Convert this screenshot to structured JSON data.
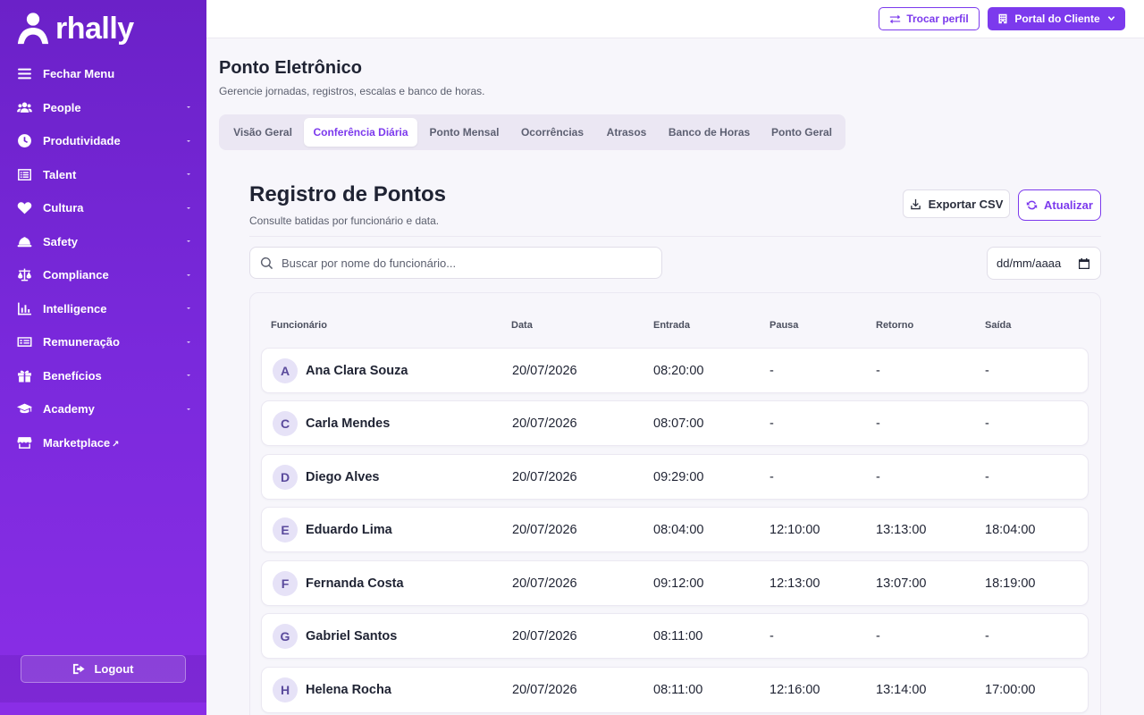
{
  "sidebar": {
    "brand": "rhally",
    "items": [
      {
        "label": "Fechar Menu",
        "icon": "menu-icon",
        "chevron": false
      },
      {
        "label": "People",
        "icon": "users-icon",
        "chevron": true
      },
      {
        "label": "Produtividade",
        "icon": "clock-icon",
        "chevron": true
      },
      {
        "label": "Talent",
        "icon": "list-icon",
        "chevron": true
      },
      {
        "label": "Cultura",
        "icon": "heart-icon",
        "chevron": true
      },
      {
        "label": "Safety",
        "icon": "helmet-icon",
        "chevron": true
      },
      {
        "label": "Compliance",
        "icon": "scale-icon",
        "chevron": true
      },
      {
        "label": "Intelligence",
        "icon": "chart-icon",
        "chevron": true
      },
      {
        "label": "Remuneração",
        "icon": "money-icon",
        "chevron": true
      },
      {
        "label": "Benefícios",
        "icon": "gift-icon",
        "chevron": true
      },
      {
        "label": "Academy",
        "icon": "graduation-icon",
        "chevron": true
      },
      {
        "label": "Marketplace",
        "icon": "store-icon",
        "chevron": false,
        "external": "↗"
      }
    ],
    "logout": "Logout"
  },
  "topbar": {
    "switch_profile": "Trocar perfil",
    "client_portal": "Portal do Cliente"
  },
  "page": {
    "title": "Ponto Eletrônico",
    "subtitle": "Gerencie jornadas, registros, escalas e banco de horas."
  },
  "tabs": [
    {
      "label": "Visão Geral",
      "active": false
    },
    {
      "label": "Conferência Diária",
      "active": true
    },
    {
      "label": "Ponto Mensal",
      "active": false
    },
    {
      "label": "Ocorrências",
      "active": false
    },
    {
      "label": "Atrasos",
      "active": false
    },
    {
      "label": "Banco de Horas",
      "active": false
    },
    {
      "label": "Ponto Geral",
      "active": false
    }
  ],
  "registro": {
    "title": "Registro de Pontos",
    "subtitle": "Consulte batidas por funcionário e data.",
    "export_label": "Exportar CSV",
    "refresh_label": "Atualizar",
    "search_placeholder": "Buscar por nome do funcionário...",
    "date_placeholder": "dd/mm/aaaa"
  },
  "table": {
    "headers": [
      "Funcionário",
      "Data",
      "Entrada",
      "Pausa",
      "Retorno",
      "Saída"
    ],
    "rows": [
      {
        "initial": "A",
        "name": "Ana Clara Souza",
        "data": "20/07/2026",
        "entrada": "08:20:00",
        "pausa": "-",
        "retorno": "-",
        "saida": "-"
      },
      {
        "initial": "C",
        "name": "Carla Mendes",
        "data": "20/07/2026",
        "entrada": "08:07:00",
        "pausa": "-",
        "retorno": "-",
        "saida": "-"
      },
      {
        "initial": "D",
        "name": "Diego Alves",
        "data": "20/07/2026",
        "entrada": "09:29:00",
        "pausa": "-",
        "retorno": "-",
        "saida": "-"
      },
      {
        "initial": "E",
        "name": "Eduardo Lima",
        "data": "20/07/2026",
        "entrada": "08:04:00",
        "pausa": "12:10:00",
        "retorno": "13:13:00",
        "saida": "18:04:00"
      },
      {
        "initial": "F",
        "name": "Fernanda Costa",
        "data": "20/07/2026",
        "entrada": "09:12:00",
        "pausa": "12:13:00",
        "retorno": "13:07:00",
        "saida": "18:19:00"
      },
      {
        "initial": "G",
        "name": "Gabriel Santos",
        "data": "20/07/2026",
        "entrada": "08:11:00",
        "pausa": "-",
        "retorno": "-",
        "saida": "-"
      },
      {
        "initial": "H",
        "name": "Helena Rocha",
        "data": "20/07/2026",
        "entrada": "08:11:00",
        "pausa": "12:16:00",
        "retorno": "13:14:00",
        "saida": "17:00:00"
      }
    ]
  },
  "colors": {
    "accent": "#7c3aed",
    "sidebar_top": "#6b21c8",
    "sidebar_bottom": "#8a2ee6"
  }
}
